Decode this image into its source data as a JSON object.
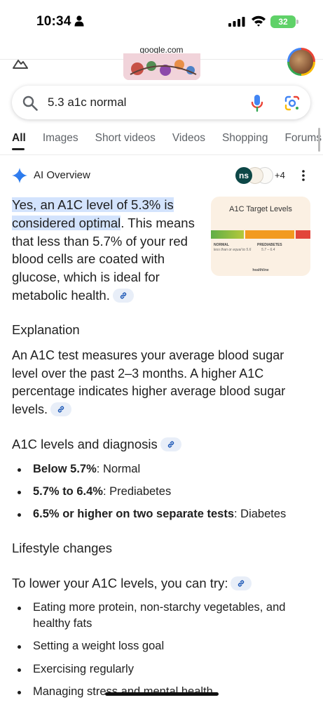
{
  "status_bar": {
    "time": "10:34",
    "battery": "32"
  },
  "browser": {
    "url": "google.com"
  },
  "search": {
    "query": "5.3 a1c normal"
  },
  "tabs": [
    {
      "label": "All"
    },
    {
      "label": "Images"
    },
    {
      "label": "Short videos"
    },
    {
      "label": "Videos"
    },
    {
      "label": "Shopping"
    },
    {
      "label": "Forums"
    }
  ],
  "ai_overview": {
    "title": "AI Overview",
    "source_avatar_text": "ns",
    "source_more": "+4",
    "answer_highlight": "Yes, an A1C level of 5.3% is considered optimal",
    "answer_rest": ". This means that less than 5.7% of your red blood cells are coated with glucose, which is ideal for metabolic health.",
    "thumbnail": {
      "title": "A1C Target Levels",
      "label_normal": "NORMAL",
      "sub_normal": "less than or equal to 5.6",
      "label_prediabetes": "PREDIABETES",
      "sub_prediabetes": "5.7 – 6.4",
      "brand": "healthline"
    }
  },
  "explanation": {
    "heading": "Explanation",
    "text": "An A1C test measures your average blood sugar level over the past 2–3 months. A higher A1C percentage indicates higher average blood sugar levels."
  },
  "diagnosis": {
    "heading": "A1C levels and diagnosis",
    "items": [
      {
        "bold": "Below 5.7%",
        "text": ": Normal"
      },
      {
        "bold": "5.7% to 6.4%",
        "text": ": Prediabetes"
      },
      {
        "bold": "6.5% or higher on two separate tests",
        "text": ": Diabetes"
      }
    ]
  },
  "lifestyle": {
    "heading": "Lifestyle changes",
    "subheading": "To lower your A1C levels, you can try:",
    "items": [
      "Eating more protein, non-starchy vegetables, and healthy fats",
      "Setting a weight loss goal",
      "Exercising regularly",
      "Managing stress and mental health"
    ]
  },
  "colors": {
    "highlight": "#d3e3fd",
    "normal_bar": "#6ab04c",
    "prediabetes_bar": "#f39c12",
    "diabetes_bar": "#e74c3c"
  },
  "icons": [
    "person-icon",
    "signal-icon",
    "wifi-icon",
    "battery-icon",
    "labs-icon",
    "search-icon",
    "mic-icon",
    "lens-icon",
    "sparkle-icon",
    "more-vert-icon",
    "link-icon"
  ]
}
